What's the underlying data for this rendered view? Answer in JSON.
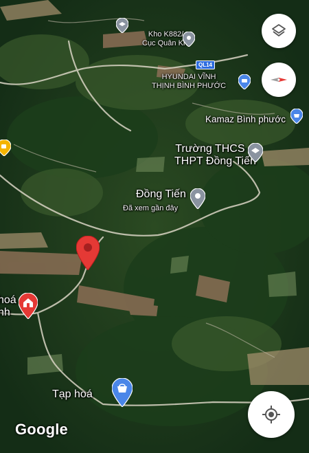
{
  "places": {
    "kho": {
      "line1": "Kho K882/",
      "line2": "Cục Quân Khí"
    },
    "hyundai": {
      "line1": "HYUNDAI VĨNH",
      "line2": "THỊNH BÌNH PHƯỚC"
    },
    "kamaz": {
      "name": "Kamaz Bình phước"
    },
    "truong": {
      "line1": "Trường THCS &",
      "line2": "THPT Đồng Tiến"
    },
    "dongtien": {
      "name": "Đồng Tiến",
      "sub": "Đã xem gần đây"
    },
    "hoa_left": {
      "line1": "hoá",
      "line2": "nh"
    },
    "taphoa": {
      "name": "Tạp hoá"
    }
  },
  "road_shield": "QL14",
  "attribution": "Google",
  "controls": {
    "layers": "layers-icon",
    "compass": "compass-icon",
    "location": "my-location-icon"
  },
  "colors": {
    "pin_red": "#e53935",
    "pin_blue": "#4a86e8",
    "pin_gray": "#8a93a0",
    "pin_orange": "#f4b400"
  }
}
